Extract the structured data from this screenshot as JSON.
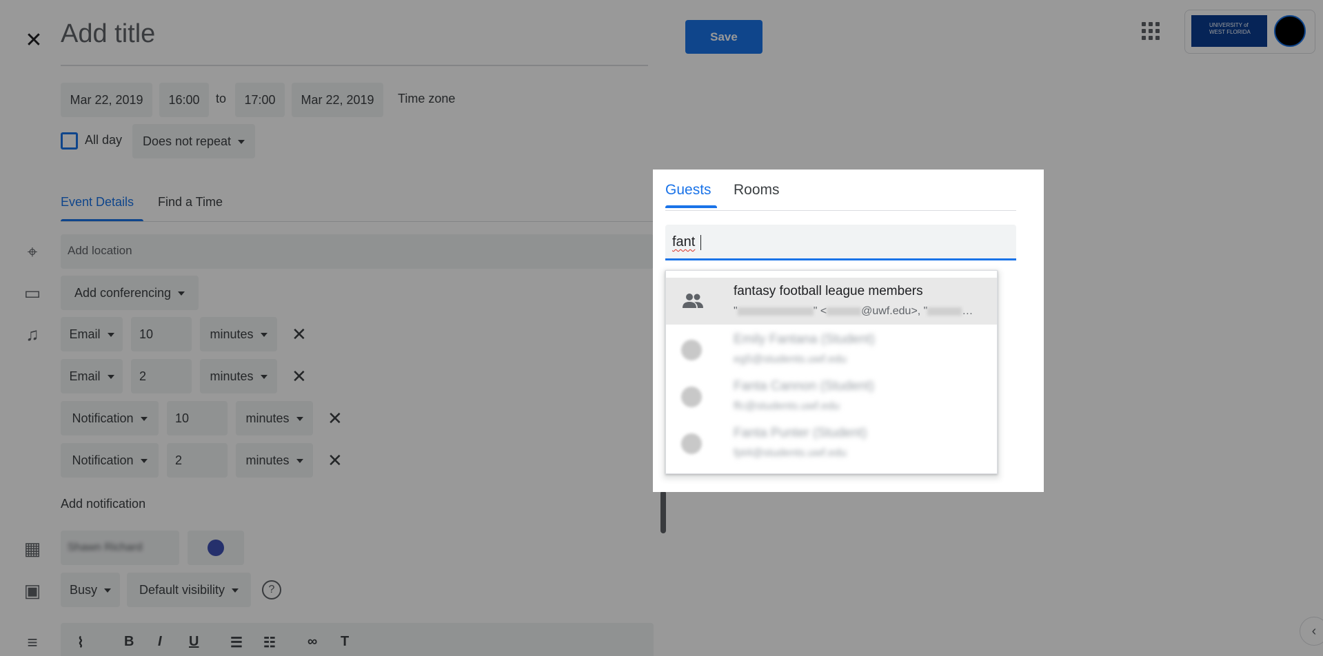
{
  "editor": {
    "title_placeholder": "Add title",
    "save_label": "Save",
    "start_date": "Mar 22, 2019",
    "start_time": "16:00",
    "to_label": "to",
    "end_time": "17:00",
    "end_date": "Mar 22, 2019",
    "time_zone_label": "Time zone",
    "all_day_label": "All day",
    "repeat_label": "Does not repeat",
    "tabs": [
      {
        "label": "Event Details"
      },
      {
        "label": "Find a Time"
      }
    ],
    "location_placeholder": "Add location",
    "conferencing_label": "Add conferencing",
    "reminders": [
      {
        "method": "Email",
        "value": "10",
        "unit": "minutes"
      },
      {
        "method": "Email",
        "value": "2",
        "unit": "minutes"
      },
      {
        "method": "Notification",
        "value": "10",
        "unit": "minutes"
      },
      {
        "method": "Notification",
        "value": "2",
        "unit": "minutes"
      }
    ],
    "add_notification_label": "Add notification",
    "calendar_owner": "Shawn Richard",
    "event_color": "#3f51b5",
    "availability_label": "Busy",
    "visibility_label": "Default visibility",
    "remove_glyph": "✕",
    "help_glyph": "?",
    "toolbar_icons": [
      "paperclip-icon",
      "bold-icon",
      "italic-icon",
      "underline-icon",
      "numbered-list-icon",
      "bulleted-list-icon",
      "link-icon",
      "clear-format-icon"
    ]
  },
  "dialog": {
    "tabs": [
      {
        "label": "Guests"
      },
      {
        "label": "Rooms"
      }
    ],
    "input_value": "fant",
    "suggestions": [
      {
        "name": "fantasy football league members",
        "email_suffix": "@uwf.edu>, \"",
        "icon": "group-icon"
      },
      {
        "name": "Emily Fantana (Student)",
        "email": "eg5@students.uwf.edu",
        "icon": "person-icon"
      },
      {
        "name": "Fanta Cannon (Student)",
        "email": "ffc@students.uwf.edu",
        "icon": "person-icon"
      },
      {
        "name": "Fanta Punter (Student)",
        "email": "fpt4@students.uwf.edu",
        "icon": "person-icon"
      }
    ]
  },
  "colors": {
    "accent": "#1a73e8",
    "scrim": "rgba(0,0,0,0.40)"
  }
}
